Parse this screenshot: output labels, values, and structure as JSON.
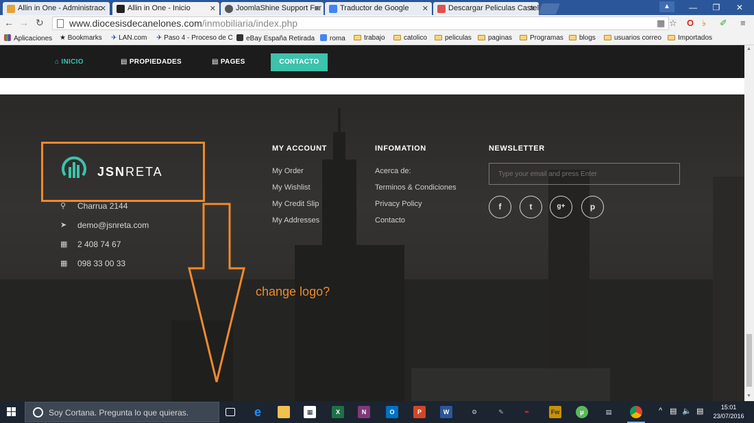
{
  "browser": {
    "tabs": [
      {
        "label": "Allin in One - Administrac",
        "active": false,
        "color": "#e3a33b"
      },
      {
        "label": "Allin in One - Inicio",
        "active": true,
        "color": "#222222"
      },
      {
        "label": "JoomlaShine Support For",
        "active": false,
        "color": "#555555"
      },
      {
        "label": "Traductor de Google",
        "active": false,
        "color": "#4285f4"
      },
      {
        "label": "Descargar Peliculas Castel",
        "active": false,
        "color": "#d9534f"
      }
    ],
    "url_host": "www.diocesisdecanelones.com",
    "url_path": "/inmobiliaria/index.php",
    "bookmarks": [
      {
        "label": "Aplicaciones",
        "icon": "apps-icon"
      },
      {
        "label": "Bookmarks",
        "icon": "star-icon"
      },
      {
        "label": "LAN.com",
        "icon": "plane-icon"
      },
      {
        "label": "Paso 4 - Proceso de C",
        "icon": "plane-icon"
      },
      {
        "label": "eBay España Retirada",
        "icon": "bag-icon"
      },
      {
        "label": "roma",
        "icon": "translate-icon"
      },
      {
        "label": "trabajo",
        "icon": "folder-icon"
      },
      {
        "label": "catolico",
        "icon": "folder-icon"
      },
      {
        "label": "peliculas",
        "icon": "folder-icon"
      },
      {
        "label": "paginas",
        "icon": "folder-icon"
      },
      {
        "label": "Programas",
        "icon": "folder-icon"
      },
      {
        "label": "blogs",
        "icon": "folder-icon"
      },
      {
        "label": "usuarios correo",
        "icon": "folder-icon"
      },
      {
        "label": "Importados",
        "icon": "folder-icon"
      }
    ]
  },
  "nav": {
    "home": "INICIO",
    "properties": "PROPIEDADES",
    "pages": "PAGES",
    "contact": "CONTACTO"
  },
  "footer": {
    "logo_bold": "JSN",
    "logo_light": "RETA",
    "contact": {
      "address": "Charrua 2144",
      "email": "demo@jsnreta.com",
      "phone1": "2 408 74 67",
      "phone2": "098 33 00 33"
    },
    "my_account": {
      "title": "MY ACCOUNT",
      "links": [
        "My Order",
        "My Wishlist",
        "My Credit Slip",
        "My Addresses"
      ]
    },
    "information": {
      "title": "INFOMATION",
      "links": [
        "Acerca de:",
        "Terminos & Condiciones",
        "Privacy Policy",
        "Contacto"
      ]
    },
    "newsletter": {
      "title": "NEWSLETTER",
      "placeholder": "Type your email and press Enter"
    },
    "social": [
      "f",
      "t",
      "g+",
      "p"
    ]
  },
  "annotation": "change logo?",
  "taskbar": {
    "cortana": "Soy Cortana. Pregunta lo que quieras.",
    "time": "15:01",
    "date": "23/07/2016"
  },
  "colors": {
    "accent": "#3dc2ac",
    "annotation": "#ef8a2c"
  }
}
